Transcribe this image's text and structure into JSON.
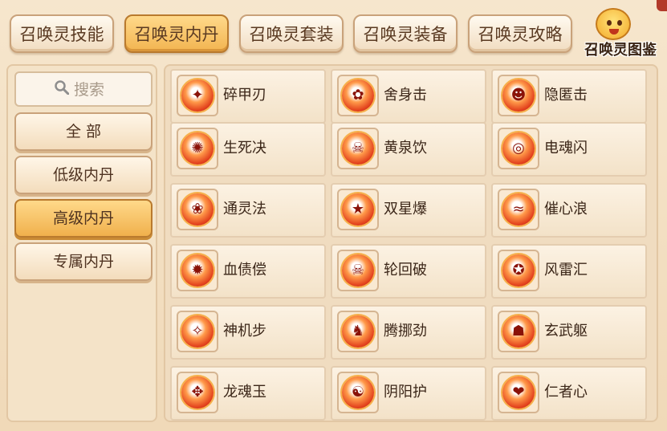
{
  "tabs": [
    {
      "label": "召唤灵技能",
      "active": false
    },
    {
      "label": "召唤灵内丹",
      "active": true
    },
    {
      "label": "召唤灵套装",
      "active": false
    },
    {
      "label": "召唤灵装备",
      "active": false
    },
    {
      "label": "召唤灵攻略",
      "active": false
    }
  ],
  "corner_badge": {
    "label": "召唤灵图鉴",
    "icon": "mascot-face-icon"
  },
  "sidebar": {
    "search_placeholder": "搜索",
    "categories": [
      {
        "label": "全 部",
        "active": false
      },
      {
        "label": "低级内丹",
        "active": false
      },
      {
        "label": "高级内丹",
        "active": true
      },
      {
        "label": "专属内丹",
        "active": false
      }
    ]
  },
  "items": [
    {
      "name": "碎甲刃",
      "icon": "blade-orb-icon"
    },
    {
      "name": "舍身击",
      "icon": "paw-orb-icon"
    },
    {
      "name": "隐匿击",
      "icon": "mask-orb-icon"
    },
    {
      "name": "生死决",
      "icon": "swirl-orb-icon"
    },
    {
      "name": "黄泉饮",
      "icon": "demon-orb-icon"
    },
    {
      "name": "电魂闪",
      "icon": "spiral-orb-icon"
    },
    {
      "name": "通灵法",
      "icon": "spirit-orb-icon"
    },
    {
      "name": "双星爆",
      "icon": "star-orb-icon"
    },
    {
      "name": "催心浪",
      "icon": "wave-orb-icon"
    },
    {
      "name": "血债偿",
      "icon": "gear-orb-icon"
    },
    {
      "name": "轮回破",
      "icon": "skull-orb-icon"
    },
    {
      "name": "风雷汇",
      "icon": "storm-orb-icon"
    },
    {
      "name": "神机步",
      "icon": "wing-orb-icon"
    },
    {
      "name": "腾挪劲",
      "icon": "figure-orb-icon"
    },
    {
      "name": "玄武躯",
      "icon": "turtle-orb-icon"
    },
    {
      "name": "龙魂玉",
      "icon": "dragon-orb-icon"
    },
    {
      "name": "阴阳护",
      "icon": "yinyang-orb-icon"
    },
    {
      "name": "仁者心",
      "icon": "heart-orb-icon"
    }
  ]
}
